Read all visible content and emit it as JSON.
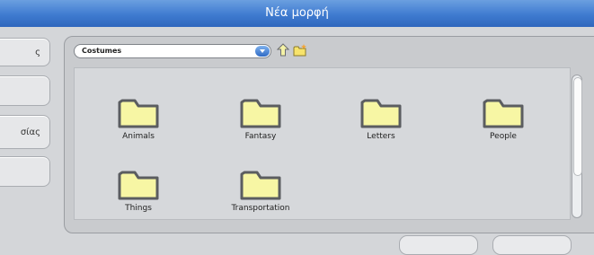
{
  "window": {
    "title": "Νέα μορφή"
  },
  "sidebar": {
    "buttons": [
      {
        "label": "ς"
      },
      {
        "label": ""
      },
      {
        "label": "σίας"
      },
      {
        "label": ""
      }
    ]
  },
  "browser": {
    "folder_dropdown": {
      "selected": "Costumes"
    },
    "up_icon": "folder-up-icon",
    "new_folder_icon": "new-folder-icon",
    "items": [
      {
        "label": "Animals",
        "icon": "folder-icon"
      },
      {
        "label": "Fantasy",
        "icon": "folder-icon"
      },
      {
        "label": "Letters",
        "icon": "folder-icon"
      },
      {
        "label": "People",
        "icon": "folder-icon"
      },
      {
        "label": "Things",
        "icon": "folder-icon"
      },
      {
        "label": "Transportation",
        "icon": "folder-icon"
      }
    ]
  },
  "colors": {
    "title_bar": "#3f7bd0",
    "folder_fill": "#f7f6a4",
    "folder_stroke": "#5b5d60"
  }
}
